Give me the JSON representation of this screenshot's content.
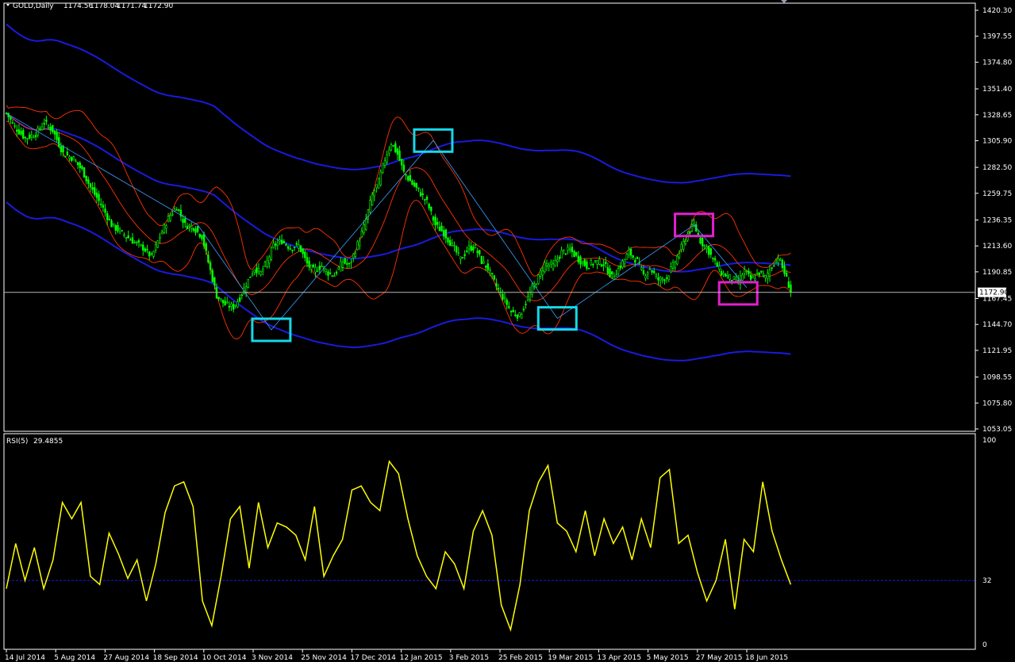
{
  "window": {
    "symbol_label": "GOLD,Daily",
    "ohlc": [
      "1174.56",
      "1178.04",
      "1171.74",
      "1172.90"
    ],
    "current_price_label": "1172.90"
  },
  "colors": {
    "background": "#000000",
    "candles": "#00ff00",
    "bollinger_bands": "#ff3300",
    "wide_envelope": "#1a1adf",
    "zigzag": "#3aa0ff",
    "highlight_box_cyan": "#16d8e8",
    "highlight_box_magenta": "#e020d0",
    "rsi_line": "#ffff00",
    "price_line": "#c0c0c0"
  },
  "chart_data": [
    {
      "type": "candlestick",
      "symbol": "GOLD",
      "timeframe": "Daily",
      "ylim": [
        1053.05,
        1420.3
      ],
      "y_ticks": [
        "1420.30",
        "1397.55",
        "1374.80",
        "1351.40",
        "1328.65",
        "1305.90",
        "1282.50",
        "1259.75",
        "1236.35",
        "1213.60",
        "1190.85",
        "1167.45",
        "1144.70",
        "1121.95",
        "1098.55",
        "1075.80",
        "1053.05"
      ],
      "x_ticks": [
        "14 Jul 2014",
        "5 Aug 2014",
        "27 Aug 2014",
        "18 Sep 2014",
        "10 Oct 2014",
        "3 Nov 2014",
        "25 Nov 2014",
        "17 Dec 2014",
        "12 Jan 2015",
        "3 Feb 2015",
        "25 Feb 2015",
        "19 Mar 2015",
        "13 Apr 2015",
        "5 May 2015",
        "27 May 2015",
        "18 Jun 2015"
      ],
      "close_path": [
        [
          0,
          1330
        ],
        [
          4,
          1318
        ],
        [
          9,
          1308
        ],
        [
          14,
          1312
        ],
        [
          18,
          1322
        ],
        [
          22,
          1315
        ],
        [
          27,
          1295
        ],
        [
          32,
          1290
        ],
        [
          36,
          1280
        ],
        [
          40,
          1265
        ],
        [
          45,
          1250
        ],
        [
          50,
          1232
        ],
        [
          55,
          1225
        ],
        [
          60,
          1218
        ],
        [
          65,
          1212
        ],
        [
          69,
          1204
        ],
        [
          73,
          1222
        ],
        [
          77,
          1238
        ],
        [
          81,
          1248
        ],
        [
          85,
          1232
        ],
        [
          89,
          1230
        ],
        [
          93,
          1222
        ],
        [
          97,
          1192
        ],
        [
          100,
          1170
        ],
        [
          104,
          1162
        ],
        [
          108,
          1160
        ],
        [
          111,
          1168
        ],
        [
          114,
          1180
        ],
        [
          118,
          1194
        ],
        [
          121,
          1190
        ],
        [
          124,
          1200
        ],
        [
          127,
          1214
        ],
        [
          131,
          1218
        ],
        [
          135,
          1212
        ],
        [
          139,
          1214
        ],
        [
          143,
          1198
        ],
        [
          146,
          1192
        ],
        [
          150,
          1196
        ],
        [
          153,
          1190
        ],
        [
          156,
          1188
        ],
        [
          160,
          1200
        ],
        [
          163,
          1196
        ],
        [
          166,
          1210
        ],
        [
          170,
          1230
        ],
        [
          174,
          1258
        ],
        [
          177,
          1270
        ],
        [
          180,
          1290
        ],
        [
          183,
          1304
        ],
        [
          186,
          1294
        ],
        [
          189,
          1278
        ],
        [
          193,
          1268
        ],
        [
          196,
          1262
        ],
        [
          200,
          1252
        ],
        [
          204,
          1232
        ],
        [
          208,
          1225
        ],
        [
          212,
          1214
        ],
        [
          216,
          1202
        ],
        [
          220,
          1212
        ],
        [
          223,
          1212
        ],
        [
          226,
          1200
        ],
        [
          229,
          1194
        ],
        [
          233,
          1178
        ],
        [
          237,
          1166
        ],
        [
          240,
          1156
        ],
        [
          244,
          1152
        ],
        [
          247,
          1164
        ],
        [
          250,
          1176
        ],
        [
          253,
          1186
        ],
        [
          256,
          1198
        ],
        [
          260,
          1196
        ],
        [
          264,
          1208
        ],
        [
          268,
          1210
        ],
        [
          272,
          1202
        ],
        [
          276,
          1196
        ],
        [
          280,
          1200
        ],
        [
          284,
          1198
        ],
        [
          288,
          1186
        ],
        [
          292,
          1196
        ],
        [
          296,
          1208
        ],
        [
          300,
          1200
        ],
        [
          303,
          1188
        ],
        [
          306,
          1194
        ],
        [
          310,
          1184
        ],
        [
          314,
          1186
        ],
        [
          318,
          1200
        ],
        [
          321,
          1212
        ],
        [
          324,
          1224
        ],
        [
          327,
          1232
        ],
        [
          330,
          1218
        ],
        [
          333,
          1212
        ],
        [
          336,
          1202
        ],
        [
          340,
          1190
        ],
        [
          344,
          1186
        ],
        [
          348,
          1182
        ],
        [
          351,
          1192
        ],
        [
          354,
          1184
        ],
        [
          358,
          1190
        ],
        [
          361,
          1186
        ],
        [
          364,
          1196
        ],
        [
          367,
          1204
        ],
        [
          370,
          1190
        ],
        [
          373,
          1174
        ]
      ],
      "series": [
        {
          "name": "RSI(5)",
          "panel": "lower",
          "current_value": "29.4855",
          "ylim": [
            0,
            100
          ],
          "level": 32
        }
      ],
      "rsi_points": [
        [
          0,
          28
        ],
        [
          4,
          50
        ],
        [
          8,
          32
        ],
        [
          12,
          48
        ],
        [
          16,
          28
        ],
        [
          20,
          42
        ],
        [
          24,
          70
        ],
        [
          28,
          62
        ],
        [
          32,
          70
        ],
        [
          36,
          34
        ],
        [
          40,
          30
        ],
        [
          44,
          55
        ],
        [
          48,
          45
        ],
        [
          52,
          33
        ],
        [
          56,
          42
        ],
        [
          60,
          22
        ],
        [
          64,
          40
        ],
        [
          68,
          65
        ],
        [
          72,
          78
        ],
        [
          76,
          80
        ],
        [
          80,
          68
        ],
        [
          84,
          22
        ],
        [
          88,
          10
        ],
        [
          92,
          34
        ],
        [
          96,
          62
        ],
        [
          100,
          68
        ],
        [
          104,
          38
        ],
        [
          108,
          70
        ],
        [
          112,
          48
        ],
        [
          116,
          60
        ],
        [
          120,
          58
        ],
        [
          124,
          54
        ],
        [
          128,
          42
        ],
        [
          132,
          68
        ],
        [
          136,
          34
        ],
        [
          140,
          44
        ],
        [
          144,
          52
        ],
        [
          148,
          76
        ],
        [
          152,
          78
        ],
        [
          156,
          70
        ],
        [
          160,
          66
        ],
        [
          164,
          90
        ],
        [
          168,
          84
        ],
        [
          172,
          62
        ],
        [
          176,
          44
        ],
        [
          180,
          34
        ],
        [
          184,
          28
        ],
        [
          188,
          46
        ],
        [
          192,
          40
        ],
        [
          196,
          28
        ],
        [
          200,
          56
        ],
        [
          204,
          66
        ],
        [
          208,
          54
        ],
        [
          212,
          20
        ],
        [
          216,
          8
        ],
        [
          220,
          30
        ],
        [
          224,
          66
        ],
        [
          228,
          80
        ],
        [
          232,
          88
        ],
        [
          236,
          60
        ],
        [
          240,
          56
        ],
        [
          244,
          46
        ],
        [
          248,
          66
        ],
        [
          252,
          44
        ],
        [
          256,
          62
        ],
        [
          260,
          50
        ],
        [
          264,
          58
        ],
        [
          268,
          42
        ],
        [
          272,
          62
        ],
        [
          276,
          48
        ],
        [
          280,
          82
        ],
        [
          284,
          86
        ],
        [
          288,
          50
        ],
        [
          292,
          54
        ],
        [
          296,
          36
        ],
        [
          300,
          22
        ],
        [
          304,
          32
        ],
        [
          308,
          52
        ],
        [
          312,
          18
        ],
        [
          316,
          52
        ],
        [
          320,
          46
        ],
        [
          324,
          80
        ],
        [
          328,
          56
        ],
        [
          332,
          42
        ],
        [
          336,
          30
        ]
      ]
    }
  ],
  "rsi_panel": {
    "label": "RSI(5)",
    "value": "29.4855",
    "scale_labels": [
      "100",
      "32",
      "0"
    ]
  }
}
